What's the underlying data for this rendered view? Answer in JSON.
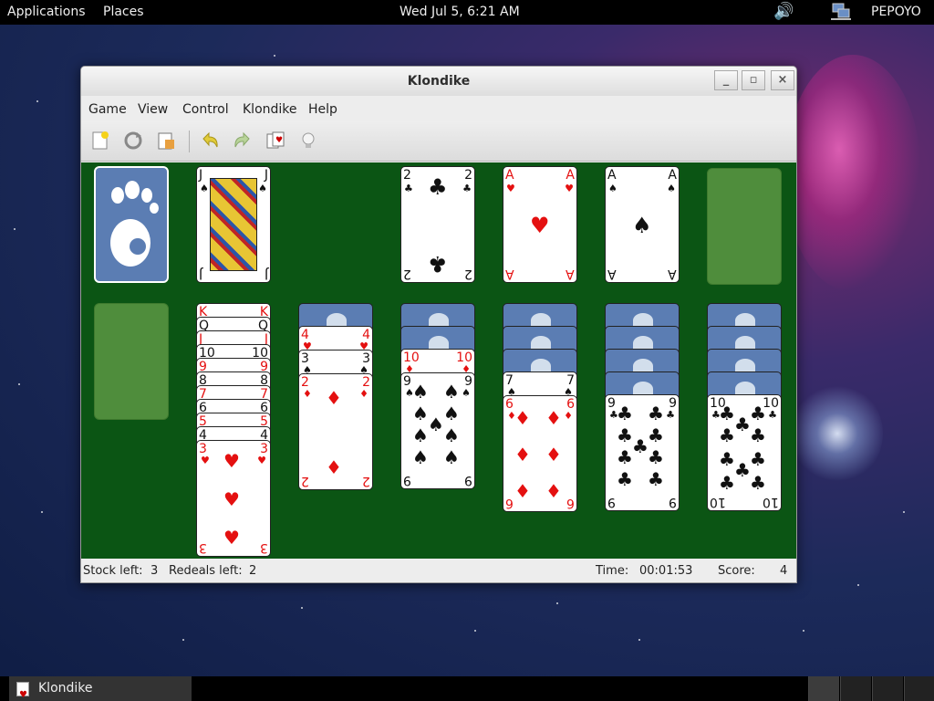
{
  "top_panel": {
    "applications": "Applications",
    "places": "Places",
    "clock": "Wed Jul  5,  6:21 AM",
    "user": "PEPOYO",
    "icons": [
      "volume-icon",
      "network-icon"
    ]
  },
  "window": {
    "title": "Klondike",
    "controls": [
      "_",
      "▫",
      "×"
    ],
    "menu": [
      "Game",
      "View",
      "Control",
      "Klondike",
      "Help"
    ],
    "toolbar_icons": [
      "new-game-icon",
      "restart-icon",
      "select-game-icon",
      "undo-icon",
      "redo-icon",
      "deal-icon",
      "hint-icon"
    ]
  },
  "cards": {
    "waste": {
      "rank": "J",
      "suit": "♠"
    },
    "foundations": [
      {
        "rank": "2",
        "suit": "♣"
      },
      {
        "rank": "A",
        "suit": "♥"
      },
      {
        "rank": "A",
        "suit": "♠"
      }
    ],
    "tableau": [
      [],
      [
        "K",
        "Q",
        "J",
        "10",
        "9",
        "8",
        "7",
        "6",
        "5",
        "4",
        "3"
      ],
      [
        "4",
        "3",
        "2"
      ],
      [
        "10",
        "9"
      ],
      [
        "7",
        "6"
      ],
      [
        "9"
      ],
      [
        "10"
      ]
    ],
    "tableau_suits": [
      [],
      [
        "♥",
        "♣",
        "♦",
        "♣",
        "♥",
        "♠",
        "♦",
        "♠",
        "♥",
        "♠",
        "♥"
      ],
      [
        "♥",
        "♠",
        "♦"
      ],
      [
        "♦",
        "♠"
      ],
      [
        "♠",
        "♦"
      ],
      [
        "♣"
      ],
      [
        "♣"
      ]
    ]
  },
  "status": {
    "stock_label": "Stock left:",
    "stock_value": "3",
    "redeals_label": "Redeals left:",
    "redeals_value": "2",
    "time_label": "Time:",
    "time_value": "00:01:53",
    "score_label": "Score:",
    "score_value": "4"
  },
  "taskbar": {
    "task_label": "Klondike"
  },
  "colors": {
    "felt": "#0b5514",
    "card_back": "#5b7db3",
    "slot": "#4f8d3c",
    "red_suit": "#e41010"
  }
}
